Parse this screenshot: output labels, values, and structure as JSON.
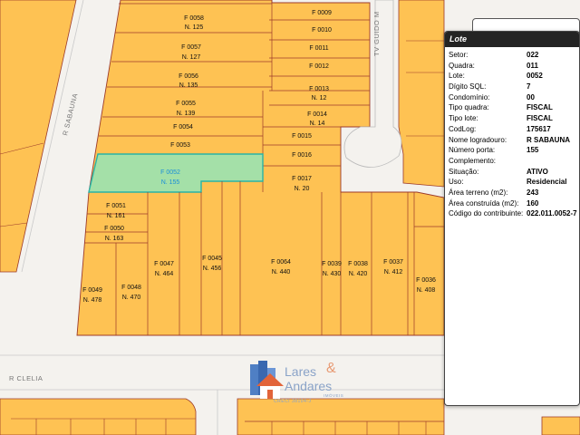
{
  "streets": {
    "sabauna": "R SABAUNA",
    "guido": "TV GUIDO M",
    "clelia": "R CLELIA"
  },
  "lots": [
    {
      "id": "F 0058",
      "num": "N. 125"
    },
    {
      "id": "F 0057",
      "num": "N. 127"
    },
    {
      "id": "F 0056",
      "num": "N. 135"
    },
    {
      "id": "F 0055",
      "num": "N. 139"
    },
    {
      "id": "F 0054",
      "num": ""
    },
    {
      "id": "F 0053",
      "num": ""
    },
    {
      "id": "F 0009",
      "num": ""
    },
    {
      "id": "F 0010",
      "num": ""
    },
    {
      "id": "F 0011",
      "num": ""
    },
    {
      "id": "F 0012",
      "num": ""
    },
    {
      "id": "F 0013",
      "num": "N. 12"
    },
    {
      "id": "F 0014",
      "num": "N. 14"
    },
    {
      "id": "F 0015",
      "num": ""
    },
    {
      "id": "F 0016",
      "num": ""
    },
    {
      "id": "F 0017",
      "num": "N. 20"
    },
    {
      "id": "F 0052",
      "num": "N. 155"
    },
    {
      "id": "F 0051",
      "num": "N. 161"
    },
    {
      "id": "F 0050",
      "num": "N. 163"
    },
    {
      "id": "F 0049",
      "num": "N. 478"
    },
    {
      "id": "F 0048",
      "num": "N. 470"
    },
    {
      "id": "F 0047",
      "num": "N. 464"
    },
    {
      "id": "F 0045",
      "num": "N. 456"
    },
    {
      "id": "F 0064",
      "num": "N. 440"
    },
    {
      "id": "F 0039",
      "num": "N. 430"
    },
    {
      "id": "F 0038",
      "num": "N. 420"
    },
    {
      "id": "F 0037",
      "num": "N. 412"
    },
    {
      "id": "F 0036",
      "num": "N. 408"
    }
  ],
  "info_panel": {
    "title": "Lote",
    "rows": [
      {
        "k": "Setor:",
        "v": "022"
      },
      {
        "k": "Quadra:",
        "v": "011"
      },
      {
        "k": "Lote:",
        "v": "0052"
      },
      {
        "k": "Dígito SQL:",
        "v": "7"
      },
      {
        "k": "Condomínio:",
        "v": "00"
      },
      {
        "k": "Tipo quadra:",
        "v": "FISCAL"
      },
      {
        "k": "Tipo lote:",
        "v": "FISCAL"
      },
      {
        "k": "CodLog:",
        "v": "175617"
      },
      {
        "k": "Nome logradouro:",
        "v": "R SABAUNA"
      },
      {
        "k": "Número porta:",
        "v": "155"
      },
      {
        "k": "Complemento:",
        "v": ""
      },
      {
        "k": "Situação:",
        "v": "ATIVO"
      },
      {
        "k": "Uso:",
        "v": "Residencial"
      },
      {
        "k": "Área terreno (m2):",
        "v": "243"
      },
      {
        "k": "Área construída (m2):",
        "v": "160"
      },
      {
        "k": "Código do contribuinte:",
        "v": "022.011.0052-7"
      }
    ]
  },
  "watermark": {
    "lares": "Lares",
    "amp": "&",
    "andares": "Andares",
    "imoveis": "IMÓVEIS",
    "creci": "CRECI 38104-J"
  },
  "colors": {
    "parcel": "#fec253",
    "parcel_border": "#9c3a2a",
    "selected": "#a4e0a8",
    "selected_border": "#29b3a6",
    "road": "#f4f2ee"
  }
}
